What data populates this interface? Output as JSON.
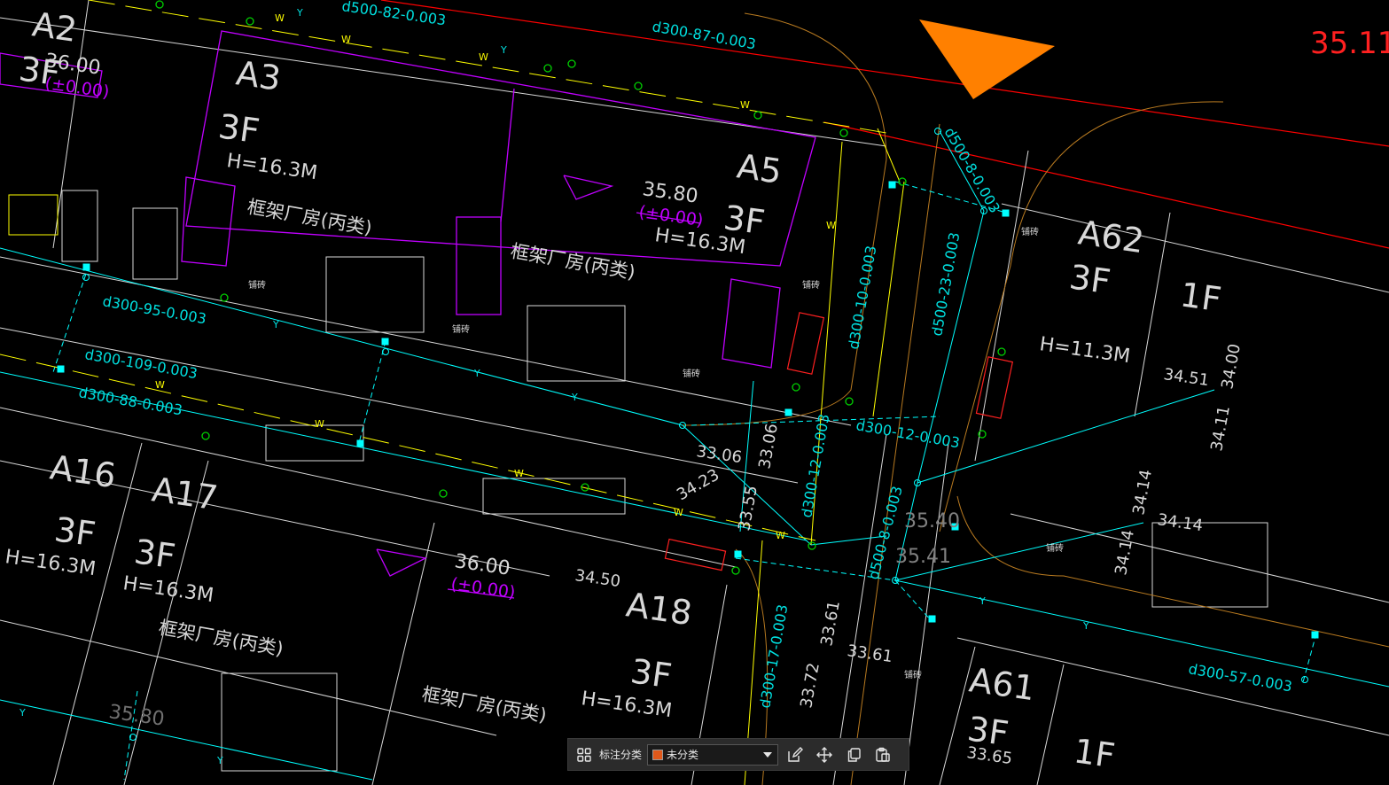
{
  "drawing": {
    "building_labels": [
      "A2",
      "A3",
      "A5",
      "A16",
      "A17",
      "A18",
      "A62",
      "A61"
    ],
    "floor_labels": [
      "3F",
      "1F"
    ],
    "height_labels": [
      "H=16.3M",
      "H=11.3M"
    ],
    "use_label": "框架厂房(丙类)",
    "paving_label": "铺砖",
    "elevations": [
      "36.00",
      "35.80",
      "36.00",
      "35.80",
      "35.11",
      "34.51",
      "34.00",
      "34.11",
      "34.14",
      "34.14",
      "34.14",
      "33.06",
      "33.06",
      "34.23",
      "33.55",
      "34.50",
      "35.40",
      "35.41",
      "33.61",
      "33.61",
      "33.72",
      "33.65"
    ],
    "relative_elevation": "(±0.00)",
    "pipe_labels": [
      "d500-82-0.003",
      "d300-87-0.003",
      "d500-8-0.003",
      "d300-95-0.003",
      "d300-109-0.003",
      "d300-88-0.003",
      "d300-10-0.003",
      "d500-23-0.003",
      "d300-12-0.003",
      "d300-12-0.003",
      "d500-8-0.003",
      "d300-17-0.003",
      "d300-57-0.003"
    ],
    "pipe_marks": [
      "W",
      "Y"
    ],
    "colors": {
      "background": "#000000",
      "water_w": "#ffff00",
      "rain_y": "#00ffff",
      "building": "#c000ff",
      "outline": "#ffffff",
      "boundary_red": "#ff0000",
      "marker_orange": "#ff8000",
      "node_green": "#00c000"
    }
  },
  "toolbar": {
    "grid_icon": "apps-grid-icon",
    "label": "标注分类",
    "select_value": "未分类",
    "select_swatch_color": "#e0581a",
    "edit_icon": "edit-icon",
    "move_icon": "move-arrows-icon",
    "copy_icon": "copy-icon",
    "paste_icon": "paste-icon"
  }
}
